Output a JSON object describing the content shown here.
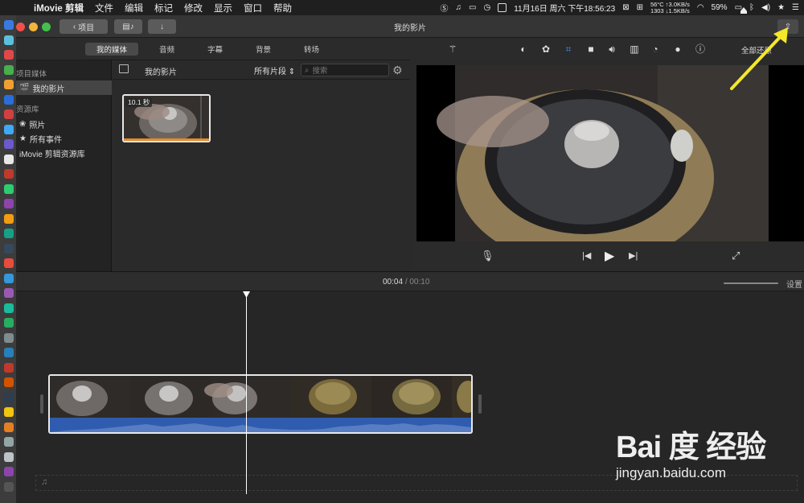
{
  "menubar": {
    "app_name": "iMovie 剪辑",
    "menus": [
      "文件",
      "编辑",
      "标记",
      "修改",
      "显示",
      "窗口",
      "帮助"
    ],
    "datetime": "11月16日 周六 下午18:56:23",
    "battery": "59%",
    "net_up": "56°C ↑3.0KB/s",
    "net_down": "1303 ↓1.5KB/s"
  },
  "toolbar": {
    "back_label": "项目",
    "title": "我的影片"
  },
  "browser_tabs": [
    "我的媒体",
    "音频",
    "字幕",
    "背景",
    "转场"
  ],
  "sidebar": {
    "section1": "项目媒体",
    "active_item": "我的影片",
    "section2": "资源库",
    "items": [
      "照片",
      "所有事件",
      "iMovie 剪辑资源库"
    ]
  },
  "browser": {
    "title": "我的影片",
    "filter": "所有片段",
    "search_placeholder": "搜索",
    "clip_duration": "10.1 秒"
  },
  "viewer": {
    "reset_all": "全部还原"
  },
  "timeline": {
    "current_time": "00:04",
    "separator": "/",
    "total_time": "00:10",
    "settings_label": "设置",
    "zoom_level": 0.66,
    "playhead_fraction": 0.4
  },
  "watermark": {
    "logo": "Bai 度 经验",
    "url": "jingyan.baidu.com"
  },
  "colors": {
    "accent_arrow": "#f5e82a",
    "audio_wave": "#2f5cae",
    "clip_bar": "#e48b2a",
    "selection": "#ffffff"
  }
}
